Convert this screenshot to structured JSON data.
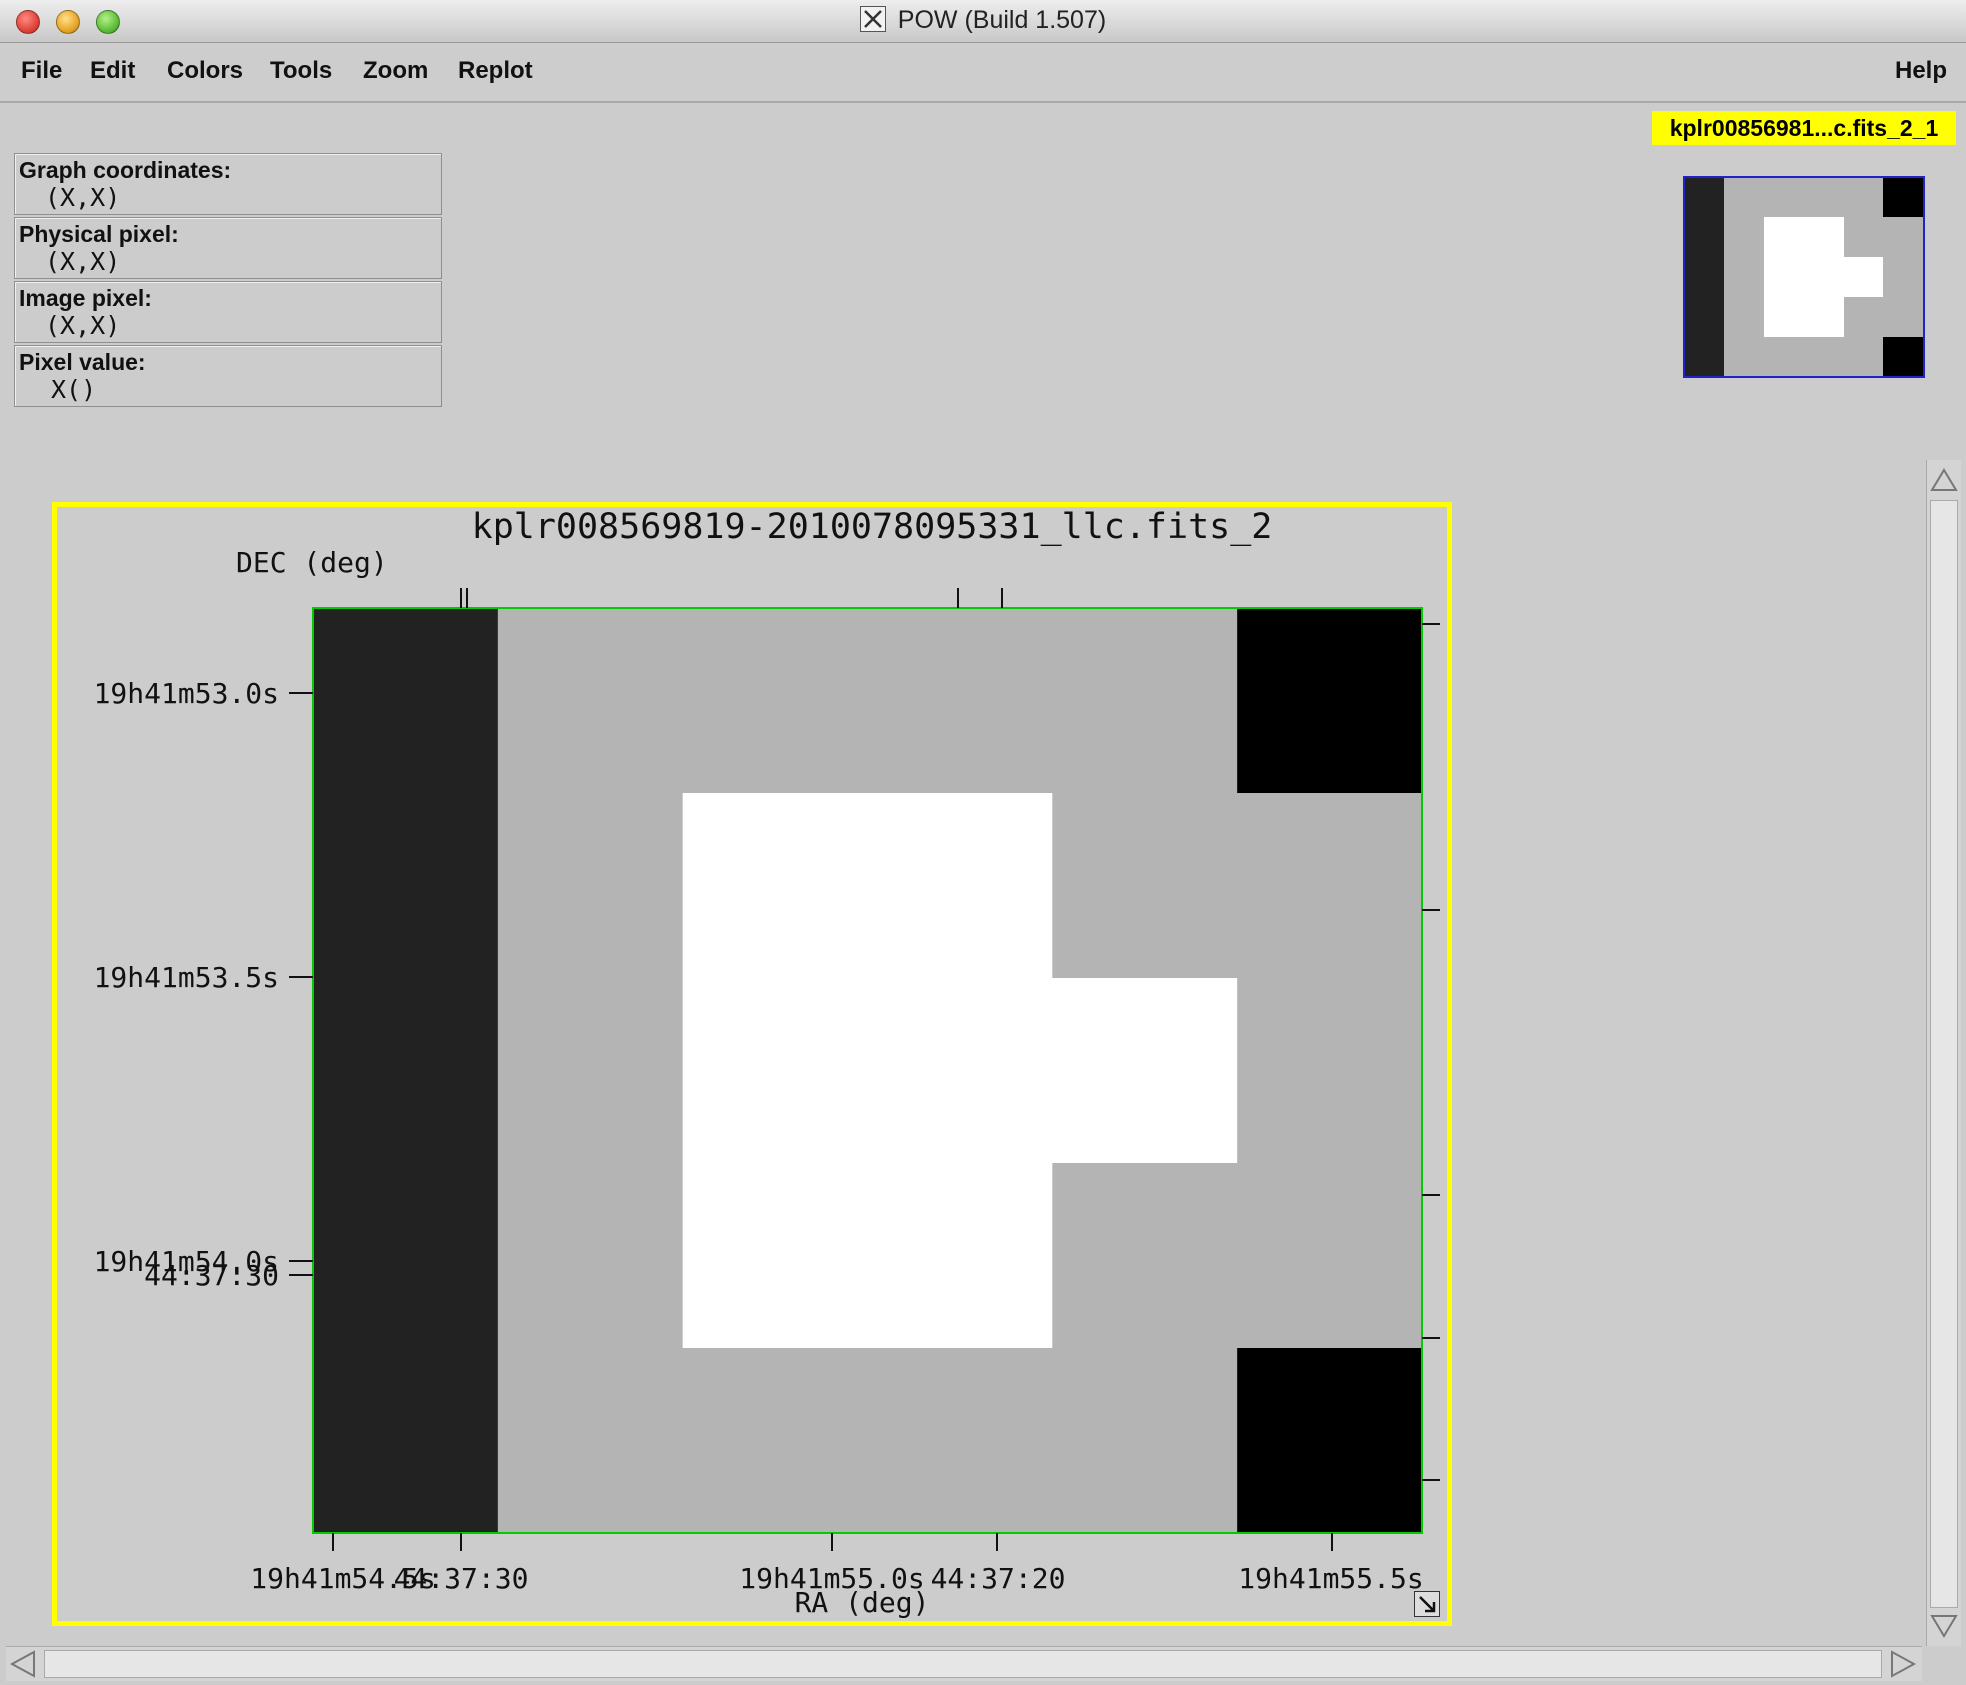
{
  "window": {
    "title": "POW (Build 1.507)"
  },
  "menu": {
    "file": "File",
    "edit": "Edit",
    "colors": "Colors",
    "tools": "Tools",
    "zoom": "Zoom",
    "replot": "Replot",
    "help": "Help"
  },
  "info_panel": {
    "graph_coordinates": {
      "label": "Graph coordinates:",
      "value": "(X,X)"
    },
    "physical_pixel": {
      "label": "Physical pixel:",
      "value": "(X,X)"
    },
    "image_pixel": {
      "label": "Image pixel:",
      "value": "(X,X)"
    },
    "pixel_value": {
      "label": "Pixel value:",
      "value": "X()"
    }
  },
  "thumbnail": {
    "graph_tag": "kplr00856981...c.fits_2_1"
  },
  "plot": {
    "title": "kplr008569819-2010078095331_llc.fits_2",
    "top_axis_label": "DEC (deg)",
    "bottom_axis_label": "RA (deg)",
    "left_tick_labels": [
      "19h41m53.0s",
      "19h41m53.5s",
      "19h41m54.0s",
      "44:37:30"
    ],
    "bottom_tick_labels": [
      "19h41m54.5s",
      "44:37:30",
      "19h41m55.0s",
      "44:37:20",
      "19h41m55.5s"
    ],
    "colors": {
      "frame": "#ffff00",
      "image_border": "#00cc00",
      "dark": "#222222",
      "black": "#000000",
      "gray": "#b4b4b4",
      "white": "#ffffff"
    },
    "image_grid_rows": [
      [
        "dark",
        "gray",
        "gray",
        "gray",
        "gray",
        "black"
      ],
      [
        "dark",
        "gray",
        "white",
        "white",
        "gray",
        "gray"
      ],
      [
        "dark",
        "gray",
        "white",
        "white",
        "white",
        "gray"
      ],
      [
        "dark",
        "gray",
        "white",
        "white",
        "gray",
        "gray"
      ],
      [
        "dark",
        "gray",
        "gray",
        "gray",
        "gray",
        "black"
      ]
    ]
  }
}
